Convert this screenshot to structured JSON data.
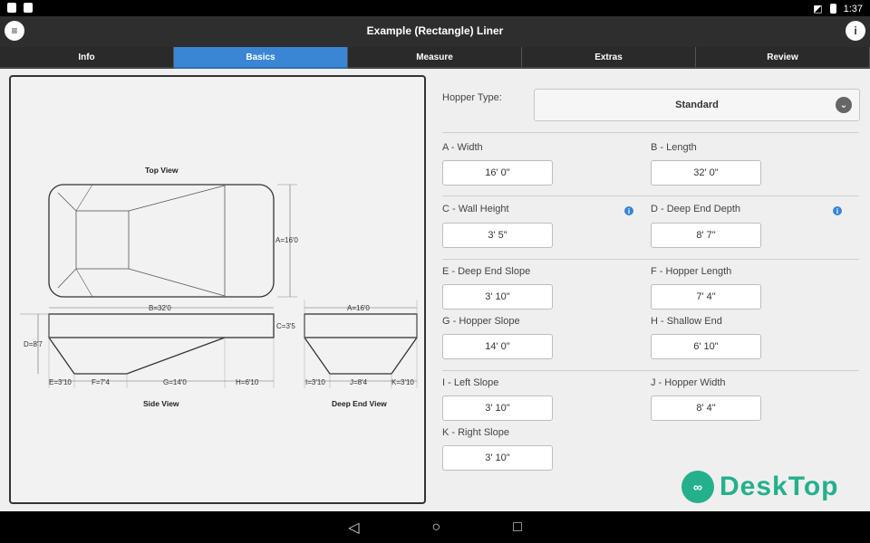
{
  "status_bar": {
    "time": "1:37",
    "icons_left": [
      "notification-icon",
      "image-icon"
    ],
    "icons_right": [
      "no-sim-icon",
      "battery-icon"
    ]
  },
  "header": {
    "title": "Example (Rectangle) Liner",
    "menu_icon": "menu-icon",
    "help_icon": "info-icon"
  },
  "tabs": [
    {
      "label": "Info",
      "active": false
    },
    {
      "label": "Basics",
      "active": true
    },
    {
      "label": "Measure",
      "active": false
    },
    {
      "label": "Extras",
      "active": false
    },
    {
      "label": "Review",
      "active": false
    }
  ],
  "diagram": {
    "top_view_label": "Top View",
    "side_view_label": "Side View",
    "deep_end_view_label": "Deep End View",
    "dims": {
      "A": "A=16'0",
      "B": "B=32'0",
      "C": "C=3'5",
      "D": "D=8'7",
      "E": "E=3'10",
      "F": "F=7'4",
      "G": "G=14'0",
      "H": "H=6'10",
      "A_end": "A=16'0",
      "I": "I=3'10",
      "J": "J=8'4",
      "K": "K=3'10"
    }
  },
  "form": {
    "hopper_type": {
      "label": "Hopper Type:",
      "value": "Standard"
    },
    "fields": {
      "a": {
        "label": "A - Width",
        "value": "16' 0\""
      },
      "b": {
        "label": "B - Length",
        "value": "32' 0\""
      },
      "c": {
        "label": "C - Wall Height",
        "value": "3' 5\""
      },
      "d": {
        "label": "D - Deep End Depth",
        "value": "8' 7\""
      },
      "e": {
        "label": "E - Deep End Slope",
        "value": "3' 10\""
      },
      "f": {
        "label": "F - Hopper Length",
        "value": "7' 4\""
      },
      "g": {
        "label": "G - Hopper Slope",
        "value": "14' 0\""
      },
      "h": {
        "label": "H - Shallow End",
        "value": "6' 10\""
      },
      "i": {
        "label": "I - Left Slope",
        "value": "3' 10\""
      },
      "j": {
        "label": "J - Hopper Width",
        "value": "8' 4\""
      },
      "k": {
        "label": "K - Right Slope",
        "value": "3' 10\""
      }
    }
  },
  "nav_bar": {
    "back": "◁",
    "home": "○",
    "recents": "□"
  },
  "watermark": {
    "text": "DeskTop"
  },
  "colors": {
    "accent": "#3a86d4",
    "header_bg": "#2e2e2e",
    "watermark": "#25b08c"
  }
}
